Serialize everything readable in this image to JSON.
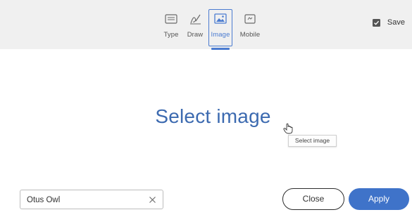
{
  "toolbar": {
    "tabs": [
      {
        "label": "Type",
        "icon": "keyboard-icon"
      },
      {
        "label": "Draw",
        "icon": "pen-icon"
      },
      {
        "label": "Image",
        "icon": "image-icon",
        "selected": true
      },
      {
        "label": "Mobile",
        "icon": "mobile-icon"
      }
    ],
    "save_label": "Save",
    "save_checked": true
  },
  "main": {
    "select_image_label": "Select image",
    "tooltip": "Select image"
  },
  "footer": {
    "name_value": "Otus Owl",
    "close_label": "Close",
    "apply_label": "Apply"
  },
  "colors": {
    "accent": "#3f73c9",
    "toolbar_bg": "#f0f0f0",
    "headline": "#3c6ab0"
  }
}
